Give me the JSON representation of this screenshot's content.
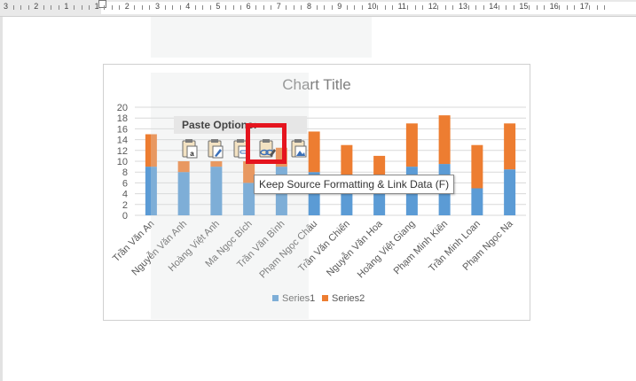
{
  "ruler": {
    "labels": [
      "3",
      "2",
      "1",
      "1",
      "2",
      "3",
      "4",
      "5",
      "6",
      "7",
      "8",
      "9",
      "10",
      "11",
      "12",
      "13",
      "14",
      "15",
      "16",
      "17"
    ]
  },
  "paste_options": {
    "title": "Paste Options:",
    "tooltip": "Keep Source Formatting & Link Data (F)",
    "buttons": [
      {
        "icon": "paste-use-destination-theme-icon"
      },
      {
        "icon": "paste-keep-source-formatting-icon"
      },
      {
        "icon": "paste-use-destination-link-icon"
      },
      {
        "icon": "paste-keep-source-link-icon"
      },
      {
        "icon": "paste-picture-icon"
      }
    ]
  },
  "chart_data": {
    "type": "bar",
    "stacked": true,
    "title": "Chart Title",
    "categories": [
      "Trần Văn An",
      "Nguyễn Văn Anh",
      "Hoàng Việt Anh",
      "Ma Ngọc Bích",
      "Trần Văn Bình",
      "Phạm Ngọc Châu",
      "Trần Văn Chiến",
      "Nguyễn Văn Hoa",
      "Hoàng Việt Giang",
      "Phạm Minh Kiên",
      "Trần Minh Loan",
      "Phạm Ngọc Na"
    ],
    "series": [
      {
        "name": "Series1",
        "color": "#5b9bd5",
        "values": [
          9,
          8,
          9,
          6,
          9,
          8,
          5,
          4,
          9,
          9.5,
          5,
          8.5
        ]
      },
      {
        "name": "Series2",
        "color": "#ed7d31",
        "values": [
          6,
          2,
          1,
          4,
          3.5,
          7.5,
          8,
          7,
          8,
          9,
          8,
          8.5
        ]
      }
    ],
    "ylim": [
      0,
      20
    ],
    "yticks": [
      0,
      2,
      4,
      6,
      8,
      10,
      12,
      14,
      16,
      18,
      20
    ],
    "grid": true,
    "legend": "bottom"
  }
}
